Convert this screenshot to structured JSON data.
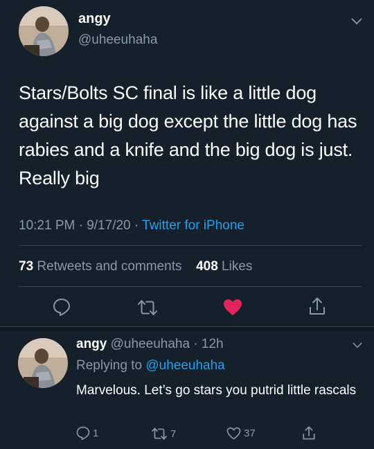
{
  "tweet": {
    "name": "angy",
    "handle": "@uheeuhaha",
    "text": "Stars/Bolts SC final is like a little dog against a big dog except the little dog has rabies and a knife and the big dog is just. Really big",
    "time": "10:21 PM · 9/17/20 · ",
    "source": "Twitter for iPhone",
    "retweets_count": "73",
    "retweets_label": " Retweets and comments",
    "likes_count": "408",
    "likes_label": " Likes",
    "liked": true,
    "like_color": "#e0245e"
  },
  "reply": {
    "name": "angy",
    "handle_time": " @uheeuhaha · 12h",
    "replying_prefix": "Replying to ",
    "replying_to": "@uheeuhaha",
    "text": "Marvelous. Let’s go stars you putrid little rascals",
    "reply_count": "1",
    "retweet_count": "7",
    "like_count": "37"
  },
  "icons": [
    "chevron-down-icon",
    "reply-icon",
    "retweet-icon",
    "heart-icon",
    "share-icon"
  ],
  "colors": {
    "background": "#15202b",
    "secondary_text": "#8899a6",
    "link": "#1da1f2",
    "divider": "#38444d"
  }
}
